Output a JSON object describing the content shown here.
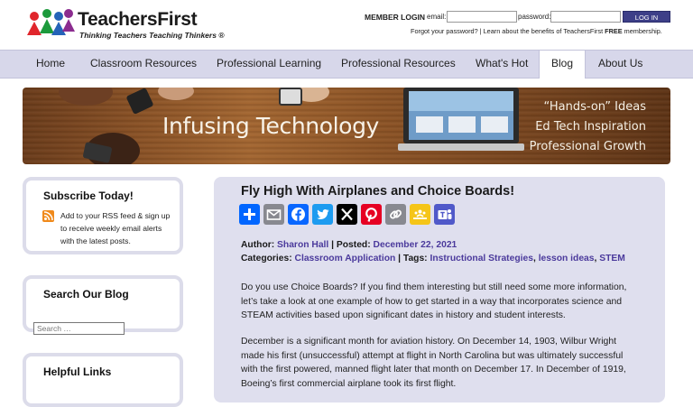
{
  "brand": {
    "name": "TeachersFirst",
    "tagline": "Thinking Teachers Teaching Thinkers ®"
  },
  "login": {
    "heading": "MEMBER LOGIN",
    "email_label": "email:",
    "password_label": "password:",
    "email_value": "",
    "password_value": "",
    "button": "LOG IN",
    "forgot": "Forgot your password?",
    "separator": "|",
    "learn_prefix": "Learn about the benefits of TeachersFirst",
    "learn_bold": "FREE",
    "learn_suffix": "membership."
  },
  "nav": {
    "items": [
      {
        "label": "Home"
      },
      {
        "label": "Classroom Resources"
      },
      {
        "label": "Professional Learning"
      },
      {
        "label": "Professional Resources"
      },
      {
        "label": "What's Hot"
      },
      {
        "label": "Blog"
      },
      {
        "label": "About Us"
      }
    ],
    "active": "Blog"
  },
  "banner": {
    "title": "Infusing Technology",
    "lines": [
      "“Hands-on” Ideas",
      "Ed Tech Inspiration",
      "Professional Growth"
    ]
  },
  "sidebar": {
    "subscribe": {
      "title": "Subscribe Today!",
      "text": "Add to your RSS feed & sign up to receive weekly email alerts with the latest posts."
    },
    "search": {
      "title": "Search Our Blog",
      "placeholder": "Search …"
    },
    "helpful": {
      "title": "Helpful Links"
    }
  },
  "post": {
    "title": "Fly High With Airplanes and Choice Boards!",
    "share_icons": [
      "share-icon",
      "email-icon",
      "facebook-icon",
      "twitter-icon",
      "x-icon",
      "pinterest-icon",
      "copy-link-icon",
      "google-classroom-icon",
      "microsoft-teams-icon"
    ],
    "author_label": "Author:",
    "author": "Sharon Hall",
    "posted_label": "| Posted:",
    "posted": "December 22, 2021",
    "categories_label": "Categories:",
    "category": "Classroom Application",
    "tags_label": "| Tags:",
    "tags": [
      "Instructional Strategies",
      "lesson ideas",
      "STEM"
    ],
    "tag_sep": ",",
    "paragraphs": [
      "Do you use Choice Boards? If you find them interesting but still need some more information, let’s take a look at one example of how to get started in a way that incorporates science and STEAM activities based upon significant dates in history and student interests.",
      "December is a significant month for aviation history. On December 14, 1903, Wilbur Wright made his first (unsuccessful) attempt at flight in North Carolina but was ultimately successful with the first powered, manned flight later that month on December 17. In December of 1919, Boeing’s first commercial airplane took its first flight."
    ]
  },
  "colors": {
    "nav_bg": "#d7d7ea",
    "post_bg": "#dfdfee",
    "link": "#4b3a9c",
    "login_button": "#3d3f88"
  }
}
